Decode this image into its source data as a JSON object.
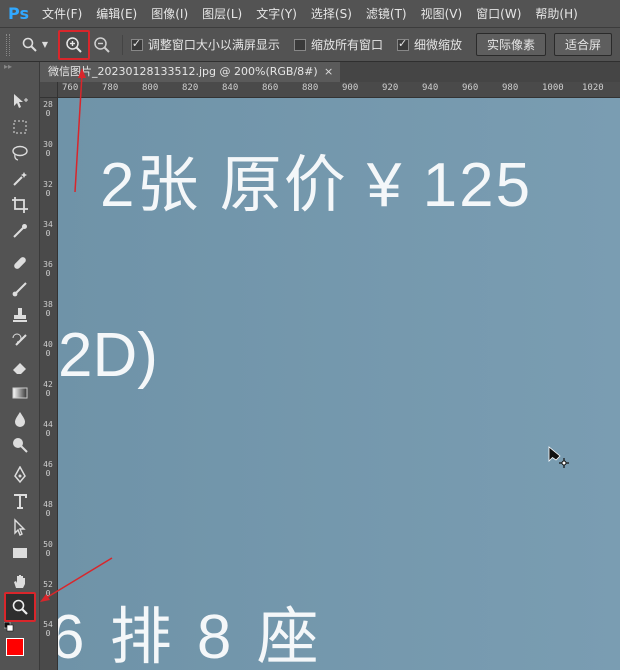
{
  "app": {
    "logo": "Ps"
  },
  "menu": [
    "文件(F)",
    "编辑(E)",
    "图像(I)",
    "图层(L)",
    "文字(Y)",
    "选择(S)",
    "滤镜(T)",
    "视图(V)",
    "窗口(W)",
    "帮助(H)"
  ],
  "options": {
    "zoom_in_icon": "zoom-in-icon",
    "zoom_out_icon": "zoom-out-icon",
    "check_resize": {
      "label": "调整窗口大小以满屏显示",
      "checked": true
    },
    "check_all_windows": {
      "label": "缩放所有窗口",
      "checked": false
    },
    "check_scrubby": {
      "label": "细微缩放",
      "checked": true
    },
    "btn_actual": "实际像素",
    "btn_fit": "适合屏"
  },
  "document": {
    "tab_title": "微信图片_20230128133512.jpg @ 200%(RGB/8#)",
    "close": "×"
  },
  "ruler_top": [
    "760",
    "780",
    "800",
    "820",
    "840",
    "860",
    "880",
    "900",
    "920",
    "940",
    "960",
    "980",
    "1000",
    "1020"
  ],
  "ruler_left": [
    "280",
    "300",
    "320",
    "340",
    "360",
    "380",
    "400",
    "420",
    "440",
    "460",
    "480",
    "500",
    "520",
    "540"
  ],
  "canvas_text": {
    "line1": "2张 原价 ¥ 125",
    "line2": "2D)",
    "line3": "6 排 8 座"
  },
  "colors": {
    "foreground": "#ff0000",
    "background": "#ffffff",
    "highlight": "#d9262b"
  }
}
